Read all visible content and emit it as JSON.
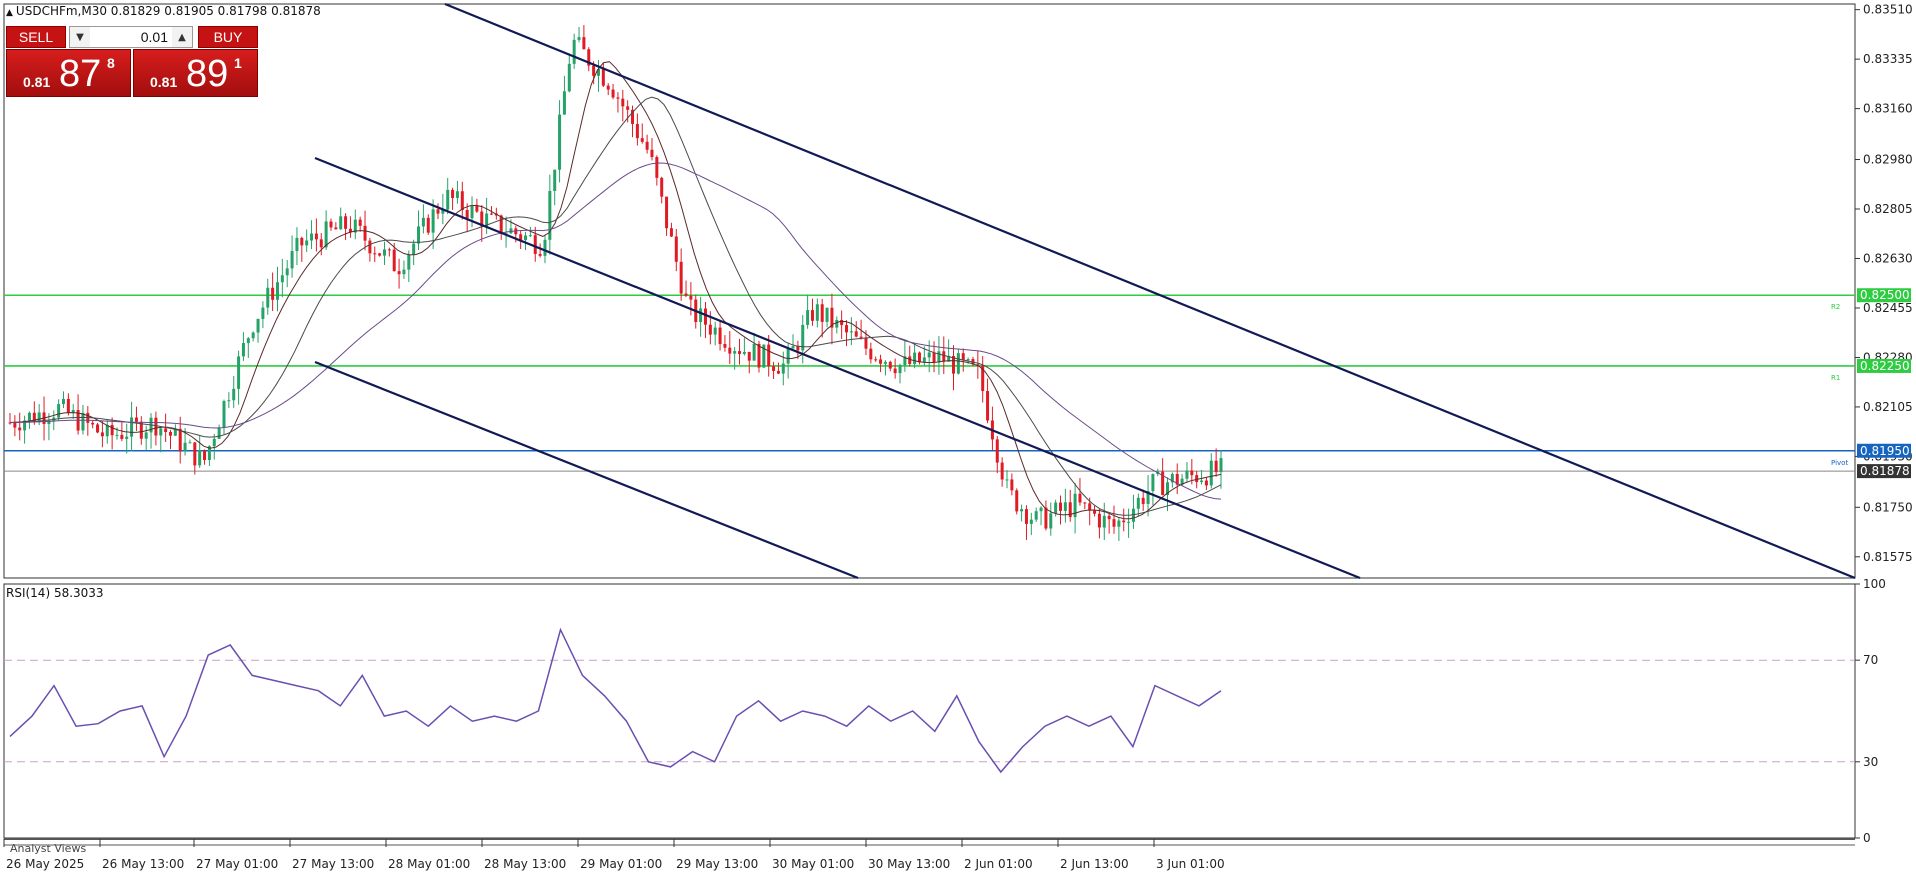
{
  "header": {
    "symbol_line": "USDCHFm,M30  0.81829 0.81905 0.81798 0.81878"
  },
  "trade": {
    "sell_label": "SELL",
    "buy_label": "BUY",
    "lot": "0.01",
    "sell_prefix": "0.81",
    "sell_big": "87",
    "sell_sup": "8",
    "buy_prefix": "0.81",
    "buy_big": "89",
    "buy_sup": "1"
  },
  "rsi": {
    "title": "RSI(14) 58.3033"
  },
  "footer": {
    "analyst_label": "Analyst Views"
  },
  "chart_data": [
    {
      "type": "candlestick",
      "title": "USDCHFm,M30",
      "ylim": [
        0.815,
        0.8353
      ],
      "price_ticks": [
        "0.83510",
        "0.83335",
        "0.83160",
        "0.82980",
        "0.82805",
        "0.82630",
        "0.82455",
        "0.82280",
        "0.82105",
        "0.81930",
        "0.81750",
        "0.81575"
      ],
      "price_tick_values": [
        0.8351,
        0.83335,
        0.8316,
        0.8298,
        0.82805,
        0.8263,
        0.82455,
        0.8228,
        0.82105,
        0.8193,
        0.8175,
        0.81575
      ],
      "x_labels": [
        "26 May 2025",
        "26 May 13:00",
        "27 May 01:00",
        "27 May 13:00",
        "28 May 01:00",
        "28 May 13:00",
        "29 May 01:00",
        "29 May 13:00",
        "30 May 01:00",
        "30 May 13:00",
        "2 Jun 01:00",
        "2 Jun 13:00",
        "3 Jun 01:00"
      ],
      "levels": [
        {
          "label": "0.82500",
          "value": 0.825,
          "color": "#2ecc40",
          "tag": "R2"
        },
        {
          "label": "0.82250",
          "value": 0.8225,
          "color": "#2ecc40",
          "tag": "R1"
        },
        {
          "label": "0.81950",
          "value": 0.8195,
          "color": "#1565c0",
          "tag": "Pivot"
        }
      ],
      "current_price_label": "0.81878",
      "current_price": 0.81878,
      "key_points": [
        {
          "x": 0,
          "y": 0.8205
        },
        {
          "x": 0.05,
          "y": 0.821
        },
        {
          "x": 0.1,
          "y": 0.82
        },
        {
          "x": 0.15,
          "y": 0.8205
        },
        {
          "x": 0.2,
          "y": 0.8191
        },
        {
          "x": 0.25,
          "y": 0.824
        },
        {
          "x": 0.3,
          "y": 0.8268
        },
        {
          "x": 0.35,
          "y": 0.8275
        },
        {
          "x": 0.4,
          "y": 0.826
        },
        {
          "x": 0.45,
          "y": 0.8285
        },
        {
          "x": 0.5,
          "y": 0.8275
        },
        {
          "x": 0.55,
          "y": 0.8268
        },
        {
          "x": 0.58,
          "y": 0.834
        },
        {
          "x": 0.62,
          "y": 0.8325
        },
        {
          "x": 0.66,
          "y": 0.83
        },
        {
          "x": 0.7,
          "y": 0.8245
        },
        {
          "x": 0.75,
          "y": 0.8232
        },
        {
          "x": 0.8,
          "y": 0.8225
        },
        {
          "x": 0.83,
          "y": 0.8245
        },
        {
          "x": 0.88,
          "y": 0.8232
        },
        {
          "x": 0.92,
          "y": 0.8225
        },
        {
          "x": 0.96,
          "y": 0.8228
        },
        {
          "x": 1.0,
          "y": 0.8222
        },
        {
          "x": 1.03,
          "y": 0.818
        },
        {
          "x": 1.06,
          "y": 0.817
        },
        {
          "x": 1.1,
          "y": 0.8176
        },
        {
          "x": 1.14,
          "y": 0.8168
        },
        {
          "x": 1.18,
          "y": 0.8183
        },
        {
          "x": 1.22,
          "y": 0.8186
        },
        {
          "x": 1.25,
          "y": 0.8188
        }
      ]
    },
    {
      "type": "line",
      "title": "RSI(14) 58.3033",
      "ylim": [
        0,
        100
      ],
      "y_ticks": [
        "100",
        "70",
        "30",
        "0"
      ],
      "levels": [
        70,
        30
      ],
      "values": [
        40,
        48,
        60,
        44,
        45,
        50,
        52,
        32,
        48,
        72,
        76,
        64,
        62,
        60,
        58,
        52,
        64,
        48,
        50,
        44,
        52,
        46,
        48,
        46,
        50,
        82,
        64,
        56,
        46,
        30,
        28,
        34,
        30,
        48,
        54,
        46,
        50,
        48,
        44,
        52,
        46,
        50,
        42,
        56,
        38,
        26,
        36,
        44,
        48,
        44,
        48,
        36,
        60,
        56,
        52,
        58
      ]
    }
  ]
}
